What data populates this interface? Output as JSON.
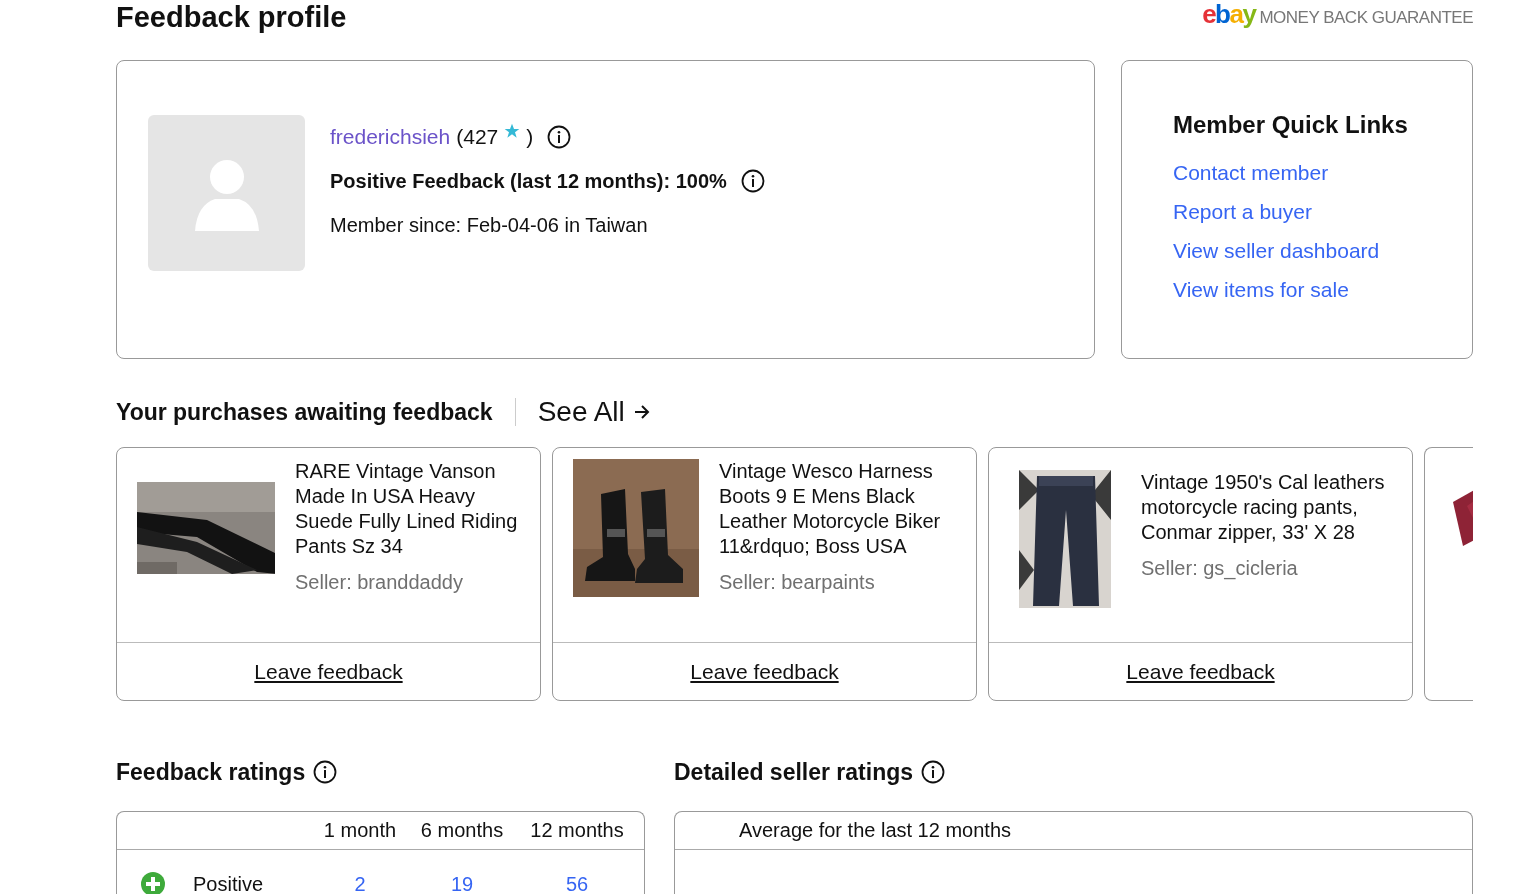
{
  "page_title": "Feedback profile",
  "guarantee_badge": {
    "logo": "ebay",
    "text": "MONEY BACK GUARANTEE"
  },
  "profile": {
    "username": "frederichsieh",
    "score": "(427",
    "score_close": ")",
    "positive_feedback": "Positive Feedback (last 12 months): 100%",
    "member_since": "Member since: Feb-04-06 in Taiwan"
  },
  "quick_links": {
    "title": "Member Quick Links",
    "links": [
      "Contact member",
      "Report a buyer",
      "View seller dashboard",
      "View items for sale"
    ]
  },
  "awaiting": {
    "title": "Your purchases awaiting feedback",
    "see_all": "See All",
    "items": [
      {
        "kind": "listing",
        "title": "RARE Vintage Vanson Made In USA Heavy Suede Fully Lined Riding Pants Sz 34",
        "seller": "Seller: branddaddy",
        "action": "Leave feedback"
      },
      {
        "kind": "listing",
        "title": "Vintage Wesco Harness Boots 9 E Mens Black Leather Motorcycle Biker 11&rdquo; Boss USA",
        "seller": "Seller: bearpaints",
        "action": "Leave feedback"
      },
      {
        "kind": "listing",
        "title": "Vintage 1950's Cal leathers motorcycle racing pants, Conmar zipper, 33' X 28",
        "seller": "Seller: gs_cicleria",
        "action": "Leave feedback"
      },
      {
        "kind": "partial"
      }
    ]
  },
  "feedback_ratings": {
    "title": "Feedback ratings",
    "columns": [
      "1 month",
      "6 months",
      "12 months"
    ],
    "rows": [
      {
        "label": "Positive",
        "values": [
          "2",
          "19",
          "56"
        ]
      }
    ]
  },
  "detailed_seller_ratings": {
    "title": "Detailed seller ratings",
    "header": "Average for the last 12 months"
  }
}
